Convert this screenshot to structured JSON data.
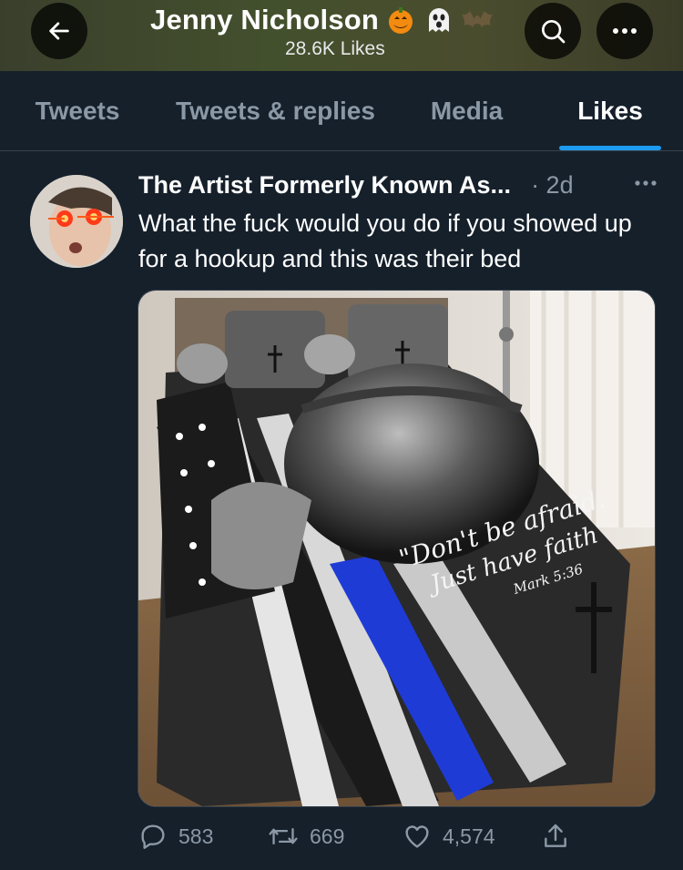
{
  "header": {
    "title": "Jenny Nicholson",
    "subtitle": "28.6K Likes",
    "title_emoji": [
      "jack-o-lantern",
      "ghost",
      "bat"
    ],
    "back_icon": "arrow-left-icon",
    "search_icon": "search-icon",
    "more_icon": "more-icon"
  },
  "tabs": [
    {
      "label": "Tweets",
      "active": false
    },
    {
      "label": "Tweets & replies",
      "active": false
    },
    {
      "label": "Media",
      "active": false
    },
    {
      "label": "Likes",
      "active": true
    }
  ],
  "tweet": {
    "author": "The Artist Formerly Known As...",
    "time": "· 2d",
    "text": "What the fuck would you do if you showed up for a hookup and this was their bed",
    "media": {
      "quote_line1": "\"Don't be afraid.",
      "quote_line2": "Just have faith",
      "quote_ref": "Mark 5:36"
    },
    "stats": {
      "replies": "583",
      "retweets": "669",
      "likes": "4,574"
    }
  },
  "colors": {
    "background": "#15202b",
    "accent": "#1d9bf0",
    "muted": "#8b98a5",
    "divider": "#38444d"
  }
}
